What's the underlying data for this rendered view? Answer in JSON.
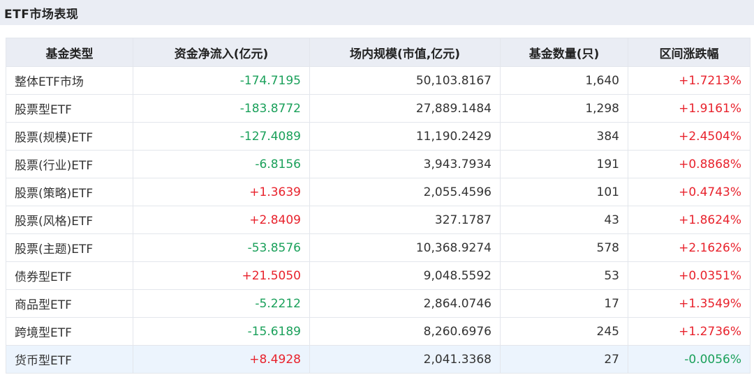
{
  "page_title": "ETF市场表现",
  "columns": [
    "基金类型",
    "资金净流入(亿元)",
    "场内规模(市值,亿元)",
    "基金数量(只)",
    "区间涨跌幅"
  ],
  "rows": [
    {
      "type": "整体ETF市场",
      "net_inflow": "-174.7195",
      "scale": "50,103.8167",
      "count": "1,640",
      "change": "+1.7213%"
    },
    {
      "type": "股票型ETF",
      "net_inflow": "-183.8772",
      "scale": "27,889.1484",
      "count": "1,298",
      "change": "+1.9161%"
    },
    {
      "type": "股票(规模)ETF",
      "net_inflow": "-127.4089",
      "scale": "11,190.2429",
      "count": "384",
      "change": "+2.4504%"
    },
    {
      "type": "股票(行业)ETF",
      "net_inflow": "-6.8156",
      "scale": "3,943.7934",
      "count": "191",
      "change": "+0.8868%"
    },
    {
      "type": "股票(策略)ETF",
      "net_inflow": "+1.3639",
      "scale": "2,055.4596",
      "count": "101",
      "change": "+0.4743%"
    },
    {
      "type": "股票(风格)ETF",
      "net_inflow": "+2.8409",
      "scale": "327.1787",
      "count": "43",
      "change": "+1.8624%"
    },
    {
      "type": "股票(主题)ETF",
      "net_inflow": "-53.8576",
      "scale": "10,368.9274",
      "count": "578",
      "change": "+2.1626%"
    },
    {
      "type": "债券型ETF",
      "net_inflow": "+21.5050",
      "scale": "9,048.5592",
      "count": "53",
      "change": "+0.0351%"
    },
    {
      "type": "商品型ETF",
      "net_inflow": "-5.2212",
      "scale": "2,864.0746",
      "count": "17",
      "change": "+1.3549%"
    },
    {
      "type": "跨境型ETF",
      "net_inflow": "-15.6189",
      "scale": "8,260.6976",
      "count": "245",
      "change": "+1.2736%"
    },
    {
      "type": "货币型ETF",
      "net_inflow": "+8.4928",
      "scale": "2,041.3368",
      "count": "27",
      "change": "-0.0056%"
    }
  ],
  "colors": {
    "positive": "#e8222c",
    "negative": "#1aa05a",
    "header_bg": "#eaedf4",
    "highlight_row_bg": "#ecf4fd"
  }
}
